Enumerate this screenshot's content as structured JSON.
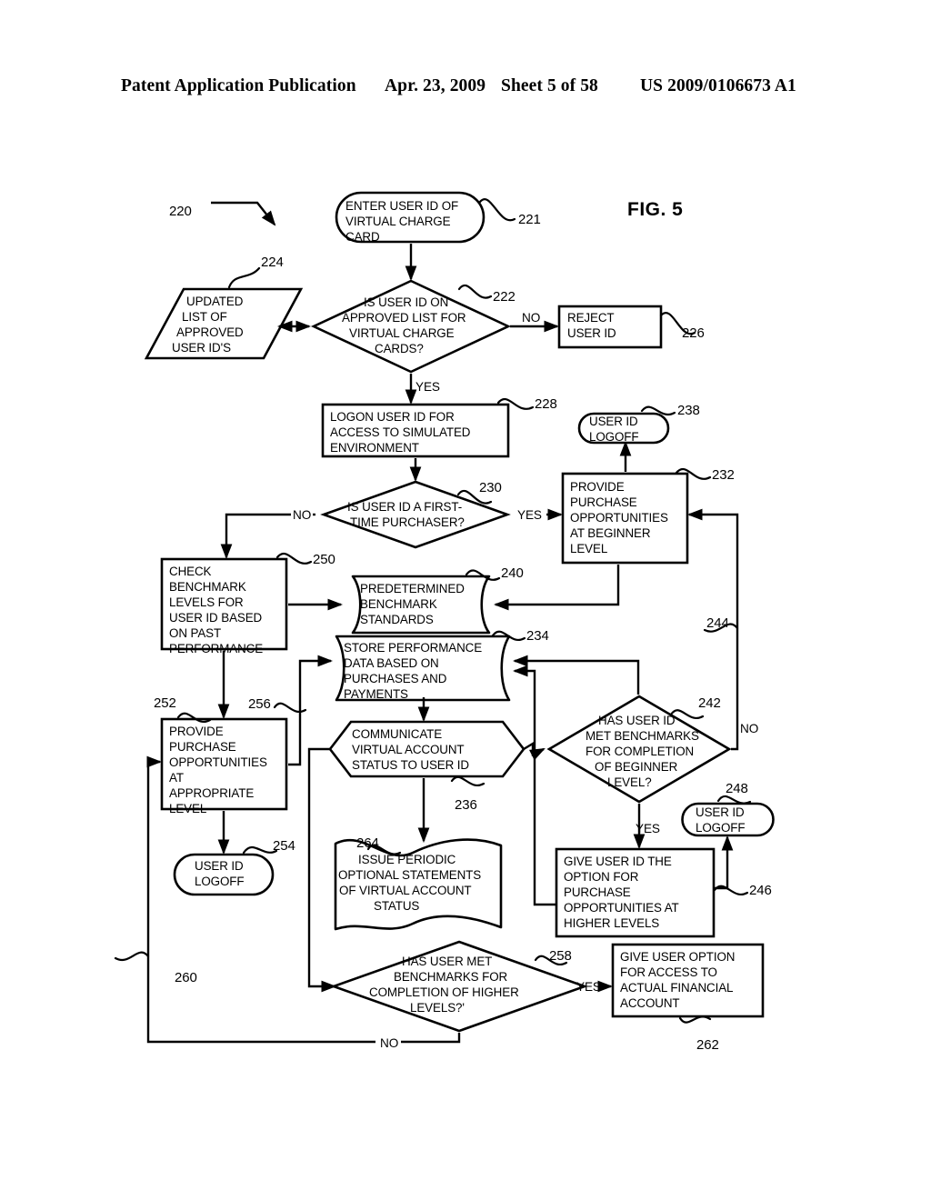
{
  "header": {
    "left": "Patent Application Publication",
    "date": "Apr. 23, 2009",
    "sheet": "Sheet 5 of 58",
    "doc_number": "US 2009/0106673 A1"
  },
  "figure": {
    "label": "FIG. 5",
    "diagram_ref": "220"
  },
  "nodes": {
    "n221": {
      "ref": "221",
      "shape": "terminator",
      "lines": [
        "ENTER USER ID OF",
        "VIRTUAL CHARGE",
        "CARD"
      ]
    },
    "n222": {
      "ref": "222",
      "shape": "decision",
      "lines": [
        "IS USER ID ON",
        "APPROVED LIST FOR",
        "VIRTUAL CHARGE",
        "CARDS?"
      ]
    },
    "n224": {
      "ref": "224",
      "shape": "parallelogram",
      "lines": [
        "UPDATED",
        "LIST OF",
        "APPROVED",
        "USER ID'S"
      ]
    },
    "n226": {
      "ref": "226",
      "shape": "process",
      "lines": [
        "REJECT",
        "USER ID"
      ]
    },
    "n228": {
      "ref": "228",
      "shape": "process",
      "lines": [
        "LOGON USER ID FOR",
        "ACCESS TO SIMULATED",
        "ENVIRONMENT"
      ]
    },
    "n230": {
      "ref": "230",
      "shape": "decision",
      "lines": [
        "IS USER ID A FIRST-",
        "TIME PURCHASER?"
      ]
    },
    "n232": {
      "ref": "232",
      "shape": "process",
      "lines": [
        "PROVIDE",
        "PURCHASE",
        "OPPORTUNITIES",
        "AT BEGINNER",
        "LEVEL"
      ]
    },
    "n238": {
      "ref": "238",
      "shape": "terminator",
      "lines": [
        "USER ID",
        "LOGOFF"
      ]
    },
    "n240": {
      "ref": "240",
      "shape": "stored-data",
      "lines": [
        "PREDETERMINED",
        "BENCHMARK",
        "STANDARDS"
      ]
    },
    "n234": {
      "ref": "234",
      "shape": "stored-data",
      "lines": [
        "STORE PERFORMANCE",
        "DATA BASED ON",
        "PURCHASES AND",
        "PAYMENTS"
      ]
    },
    "n242": {
      "ref": "242",
      "shape": "decision",
      "lines": [
        "HAS USER ID",
        "MET BENCHMARKS",
        "FOR COMPLETION",
        "OF BEGINNER",
        "LEVEL?"
      ]
    },
    "n244": {
      "ref": "244",
      "shape": "connector-label",
      "lines": []
    },
    "n246": {
      "ref": "246",
      "shape": "process",
      "lines": [
        "GIVE  USER ID THE",
        "OPTION FOR",
        "PURCHASE",
        "OPPORTUNITIES AT",
        "HIGHER LEVELS"
      ]
    },
    "n248": {
      "ref": "248",
      "shape": "terminator",
      "lines": [
        "USER ID",
        "LOGOFF"
      ]
    },
    "n250": {
      "ref": "250",
      "shape": "process",
      "lines": [
        "CHECK",
        "BENCHMARK",
        "LEVELS FOR",
        "USER ID BASED",
        "ON PAST",
        "PERFORMANCE"
      ]
    },
    "n252": {
      "ref": "252",
      "shape": "process",
      "lines": [
        "PROVIDE",
        "PURCHASE",
        "OPPORTUNITIES",
        "AT",
        "APPROPRIATE",
        "LEVEL"
      ]
    },
    "n254": {
      "ref": "254",
      "shape": "terminator",
      "lines": [
        "USER ID",
        "LOGOFF"
      ]
    },
    "n256": {
      "ref": "256",
      "shape": "connector-label",
      "lines": []
    },
    "n236": {
      "ref": "236",
      "shape": "hexagon",
      "lines": [
        "COMMUNICATE",
        "VIRTUAL ACCOUNT",
        "STATUS TO USER ID"
      ]
    },
    "n264": {
      "ref": "264",
      "shape": "document",
      "lines": [
        "ISSUE PERIODIC",
        "OPTIONAL STATEMENTS",
        "OF VIRTUAL ACCOUNT",
        "STATUS"
      ]
    },
    "n258": {
      "ref": "258",
      "shape": "decision",
      "lines": [
        "HAS USER MET",
        "BENCHMARKS FOR",
        "COMPLETION OF HIGHER",
        "LEVELS?'"
      ]
    },
    "n260": {
      "ref": "260",
      "shape": "connector-label",
      "lines": []
    },
    "n262": {
      "ref": "262",
      "shape": "process",
      "lines": [
        "GIVE USER OPTION",
        "FOR ACCESS TO",
        "ACTUAL FINANCIAL",
        "ACCOUNT"
      ]
    }
  },
  "edge_labels": {
    "e222_no": "NO",
    "e222_yes": "YES",
    "e230_no": "NO",
    "e230_yes": "YES",
    "e242_no": "NO",
    "e242_yes": "YES",
    "e258_no": "NO",
    "e258_yes": "YES"
  },
  "colors": {
    "ink": "#000000",
    "paper": "#ffffff"
  }
}
